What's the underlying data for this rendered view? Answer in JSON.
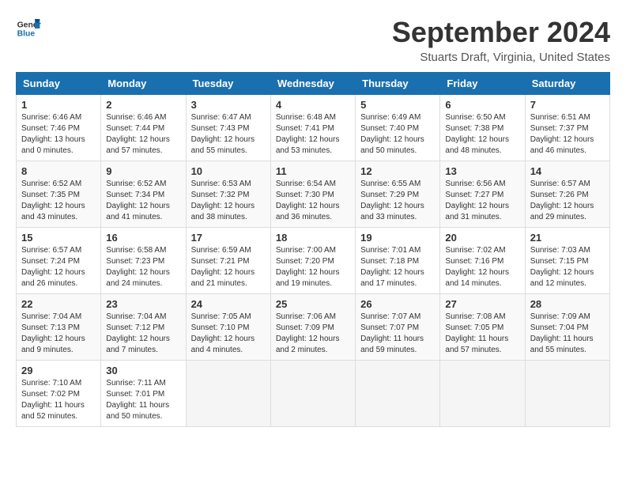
{
  "logo": {
    "line1": "General",
    "line2": "Blue"
  },
  "title": "September 2024",
  "subtitle": "Stuarts Draft, Virginia, United States",
  "days_header": [
    "Sunday",
    "Monday",
    "Tuesday",
    "Wednesday",
    "Thursday",
    "Friday",
    "Saturday"
  ],
  "weeks": [
    [
      {
        "day": "1",
        "info": "Sunrise: 6:46 AM\nSunset: 7:46 PM\nDaylight: 13 hours\nand 0 minutes."
      },
      {
        "day": "2",
        "info": "Sunrise: 6:46 AM\nSunset: 7:44 PM\nDaylight: 12 hours\nand 57 minutes."
      },
      {
        "day": "3",
        "info": "Sunrise: 6:47 AM\nSunset: 7:43 PM\nDaylight: 12 hours\nand 55 minutes."
      },
      {
        "day": "4",
        "info": "Sunrise: 6:48 AM\nSunset: 7:41 PM\nDaylight: 12 hours\nand 53 minutes."
      },
      {
        "day": "5",
        "info": "Sunrise: 6:49 AM\nSunset: 7:40 PM\nDaylight: 12 hours\nand 50 minutes."
      },
      {
        "day": "6",
        "info": "Sunrise: 6:50 AM\nSunset: 7:38 PM\nDaylight: 12 hours\nand 48 minutes."
      },
      {
        "day": "7",
        "info": "Sunrise: 6:51 AM\nSunset: 7:37 PM\nDaylight: 12 hours\nand 46 minutes."
      }
    ],
    [
      {
        "day": "8",
        "info": "Sunrise: 6:52 AM\nSunset: 7:35 PM\nDaylight: 12 hours\nand 43 minutes."
      },
      {
        "day": "9",
        "info": "Sunrise: 6:52 AM\nSunset: 7:34 PM\nDaylight: 12 hours\nand 41 minutes."
      },
      {
        "day": "10",
        "info": "Sunrise: 6:53 AM\nSunset: 7:32 PM\nDaylight: 12 hours\nand 38 minutes."
      },
      {
        "day": "11",
        "info": "Sunrise: 6:54 AM\nSunset: 7:30 PM\nDaylight: 12 hours\nand 36 minutes."
      },
      {
        "day": "12",
        "info": "Sunrise: 6:55 AM\nSunset: 7:29 PM\nDaylight: 12 hours\nand 33 minutes."
      },
      {
        "day": "13",
        "info": "Sunrise: 6:56 AM\nSunset: 7:27 PM\nDaylight: 12 hours\nand 31 minutes."
      },
      {
        "day": "14",
        "info": "Sunrise: 6:57 AM\nSunset: 7:26 PM\nDaylight: 12 hours\nand 29 minutes."
      }
    ],
    [
      {
        "day": "15",
        "info": "Sunrise: 6:57 AM\nSunset: 7:24 PM\nDaylight: 12 hours\nand 26 minutes."
      },
      {
        "day": "16",
        "info": "Sunrise: 6:58 AM\nSunset: 7:23 PM\nDaylight: 12 hours\nand 24 minutes."
      },
      {
        "day": "17",
        "info": "Sunrise: 6:59 AM\nSunset: 7:21 PM\nDaylight: 12 hours\nand 21 minutes."
      },
      {
        "day": "18",
        "info": "Sunrise: 7:00 AM\nSunset: 7:20 PM\nDaylight: 12 hours\nand 19 minutes."
      },
      {
        "day": "19",
        "info": "Sunrise: 7:01 AM\nSunset: 7:18 PM\nDaylight: 12 hours\nand 17 minutes."
      },
      {
        "day": "20",
        "info": "Sunrise: 7:02 AM\nSunset: 7:16 PM\nDaylight: 12 hours\nand 14 minutes."
      },
      {
        "day": "21",
        "info": "Sunrise: 7:03 AM\nSunset: 7:15 PM\nDaylight: 12 hours\nand 12 minutes."
      }
    ],
    [
      {
        "day": "22",
        "info": "Sunrise: 7:04 AM\nSunset: 7:13 PM\nDaylight: 12 hours\nand 9 minutes."
      },
      {
        "day": "23",
        "info": "Sunrise: 7:04 AM\nSunset: 7:12 PM\nDaylight: 12 hours\nand 7 minutes."
      },
      {
        "day": "24",
        "info": "Sunrise: 7:05 AM\nSunset: 7:10 PM\nDaylight: 12 hours\nand 4 minutes."
      },
      {
        "day": "25",
        "info": "Sunrise: 7:06 AM\nSunset: 7:09 PM\nDaylight: 12 hours\nand 2 minutes."
      },
      {
        "day": "26",
        "info": "Sunrise: 7:07 AM\nSunset: 7:07 PM\nDaylight: 11 hours\nand 59 minutes."
      },
      {
        "day": "27",
        "info": "Sunrise: 7:08 AM\nSunset: 7:05 PM\nDaylight: 11 hours\nand 57 minutes."
      },
      {
        "day": "28",
        "info": "Sunrise: 7:09 AM\nSunset: 7:04 PM\nDaylight: 11 hours\nand 55 minutes."
      }
    ],
    [
      {
        "day": "29",
        "info": "Sunrise: 7:10 AM\nSunset: 7:02 PM\nDaylight: 11 hours\nand 52 minutes."
      },
      {
        "day": "30",
        "info": "Sunrise: 7:11 AM\nSunset: 7:01 PM\nDaylight: 11 hours\nand 50 minutes."
      },
      {
        "day": "",
        "info": ""
      },
      {
        "day": "",
        "info": ""
      },
      {
        "day": "",
        "info": ""
      },
      {
        "day": "",
        "info": ""
      },
      {
        "day": "",
        "info": ""
      }
    ]
  ]
}
